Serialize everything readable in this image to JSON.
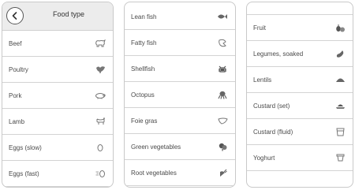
{
  "panel1": {
    "header_title": "Food type",
    "items": [
      {
        "label": "Beef",
        "icon": "beef-icon"
      },
      {
        "label": "Poultry",
        "icon": "poultry-icon"
      },
      {
        "label": "Pork",
        "icon": "pork-icon"
      },
      {
        "label": "Lamb",
        "icon": "lamb-icon"
      },
      {
        "label": "Eggs (slow)",
        "icon": "egg-slow-icon"
      },
      {
        "label": "Eggs (fast)",
        "icon": "egg-fast-icon"
      }
    ]
  },
  "panel2": {
    "items": [
      {
        "label": "Lean fish",
        "icon": "lean-fish-icon"
      },
      {
        "label": "Fatty fish",
        "icon": "fatty-fish-icon"
      },
      {
        "label": "Shellfish",
        "icon": "shellfish-icon"
      },
      {
        "label": "Octopus",
        "icon": "octopus-icon"
      },
      {
        "label": "Foie gras",
        "icon": "foie-gras-icon"
      },
      {
        "label": "Green vegetables",
        "icon": "green-vegetables-icon"
      },
      {
        "label": "Root vegetables",
        "icon": "root-vegetables-icon"
      }
    ]
  },
  "panel3": {
    "items": [
      {
        "label": "Fruit",
        "icon": "fruit-icon"
      },
      {
        "label": "Legumes, soaked",
        "icon": "legumes-icon"
      },
      {
        "label": "Lentils",
        "icon": "lentils-icon"
      },
      {
        "label": "Custard (set)",
        "icon": "custard-set-icon"
      },
      {
        "label": "Custard (fluid)",
        "icon": "custard-fluid-icon"
      },
      {
        "label": "Yoghurt",
        "icon": "yoghurt-icon"
      }
    ]
  }
}
